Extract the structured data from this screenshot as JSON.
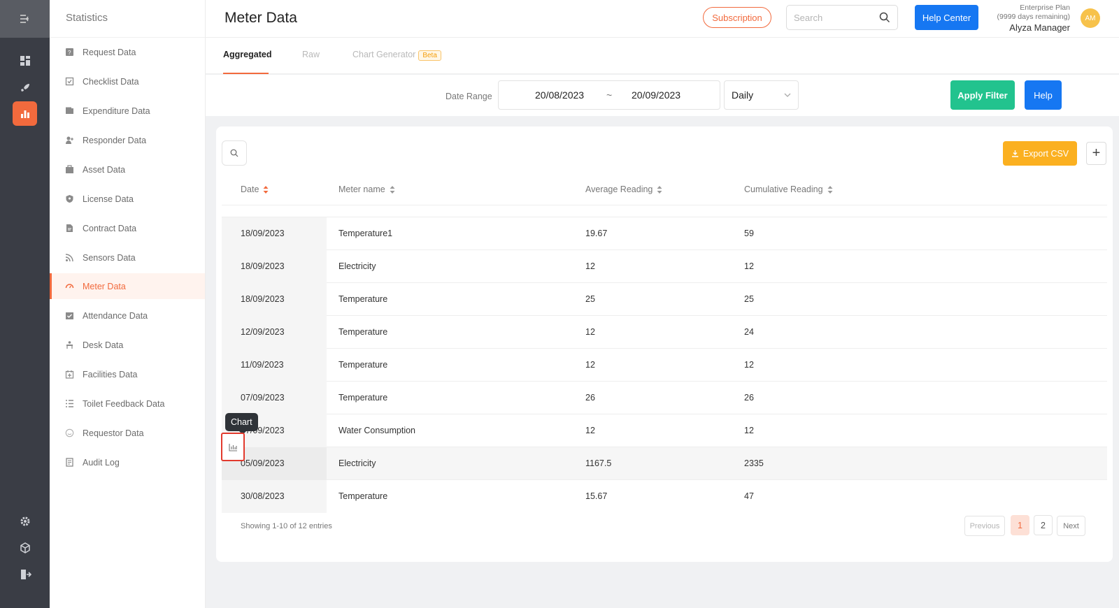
{
  "sidebar": {
    "title": "Statistics",
    "items": [
      {
        "label": "Request Data",
        "icon": "request-icon"
      },
      {
        "label": "Checklist Data",
        "icon": "checklist-icon"
      },
      {
        "label": "Expenditure Data",
        "icon": "wallet-icon"
      },
      {
        "label": "Responder Data",
        "icon": "responder-icon"
      },
      {
        "label": "Asset Data",
        "icon": "asset-icon"
      },
      {
        "label": "License Data",
        "icon": "shield-icon"
      },
      {
        "label": "Contract Data",
        "icon": "contract-icon"
      },
      {
        "label": "Sensors Data",
        "icon": "sensor-icon"
      },
      {
        "label": "Meter Data",
        "icon": "gauge-icon"
      },
      {
        "label": "Attendance Data",
        "icon": "attendance-icon"
      },
      {
        "label": "Desk Data",
        "icon": "desk-icon"
      },
      {
        "label": "Facilities Data",
        "icon": "calendar-icon"
      },
      {
        "label": "Toilet Feedback Data",
        "icon": "list-icon"
      },
      {
        "label": "Requestor Data",
        "icon": "smile-icon"
      },
      {
        "label": "Audit Log",
        "icon": "log-icon"
      }
    ],
    "active_index": 8
  },
  "header": {
    "title": "Meter Data",
    "subscription_label": "Subscription",
    "search_placeholder": "Search",
    "help_center_label": "Help Center",
    "plan": "Enterprise Plan",
    "plan_remaining": "(9999 days remaining)",
    "user_name": "Alyza Manager",
    "avatar_initials": "AM"
  },
  "tabs": {
    "aggregated": "Aggregated",
    "raw": "Raw",
    "chart_generator": "Chart Generator",
    "beta": "Beta"
  },
  "filter": {
    "label": "Date Range",
    "start": "20/08/2023",
    "separator": "~",
    "end": "20/09/2023",
    "period": "Daily",
    "apply_label": "Apply Filter",
    "help_label": "Help"
  },
  "table": {
    "export_label": "Export CSV",
    "add_label": "+",
    "columns": [
      "Date",
      "Meter name",
      "Average Reading",
      "Cumulative Reading"
    ],
    "rows": [
      {
        "date": "18/09/2023",
        "meter": "Temperature1",
        "avg": "19.67",
        "cum": "59"
      },
      {
        "date": "18/09/2023",
        "meter": "Electricity",
        "avg": "12",
        "cum": "12"
      },
      {
        "date": "18/09/2023",
        "meter": "Temperature",
        "avg": "25",
        "cum": "25"
      },
      {
        "date": "12/09/2023",
        "meter": "Temperature",
        "avg": "12",
        "cum": "24"
      },
      {
        "date": "11/09/2023",
        "meter": "Temperature",
        "avg": "12",
        "cum": "12"
      },
      {
        "date": "07/09/2023",
        "meter": "Temperature",
        "avg": "26",
        "cum": "26"
      },
      {
        "date": "07/09/2023",
        "meter": "Water Consumption",
        "avg": "12",
        "cum": "12"
      },
      {
        "date": "05/09/2023",
        "meter": "Electricity",
        "avg": "1167.5",
        "cum": "2335"
      },
      {
        "date": "30/08/2023",
        "meter": "Temperature",
        "avg": "15.67",
        "cum": "47"
      }
    ],
    "tooltip": "Chart",
    "entries_text": "Showing 1-10 of 12 entries",
    "pagination": {
      "previous": "Previous",
      "pages": [
        "1",
        "2"
      ],
      "next": "Next"
    }
  },
  "colors": {
    "accent": "#f26a3d",
    "primary": "#1677f2",
    "success": "#22c38e",
    "warning": "#fbb020"
  }
}
